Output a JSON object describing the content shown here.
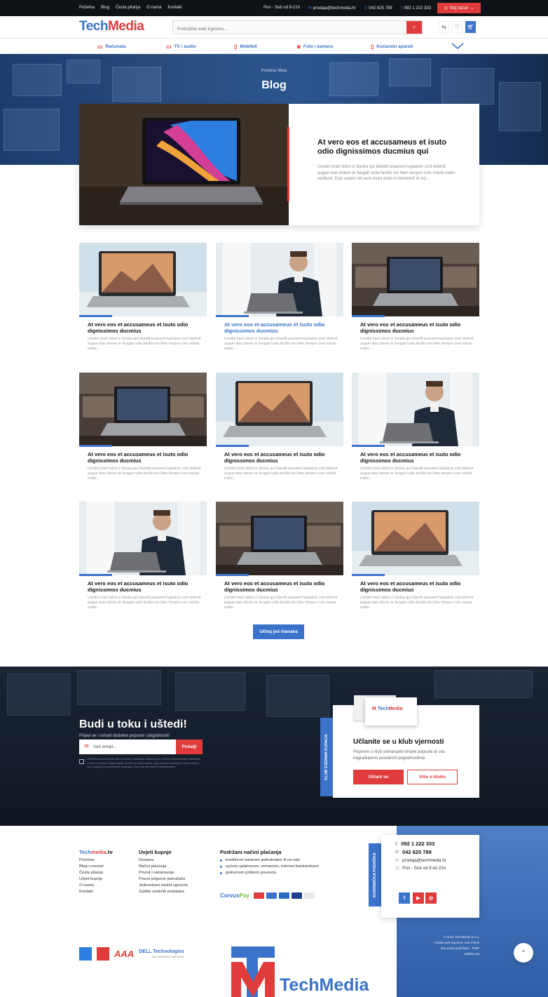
{
  "topbar": {
    "links": [
      "Početna",
      "Blog",
      "Česta pitanja",
      "O nama",
      "Kontakt"
    ],
    "hours": "Pon - Sub od 8-21h",
    "email": "prodaja@techmedia.hr",
    "phone1": "042 625 789",
    "phone2": "092 1 222 333",
    "account": "Moj račun"
  },
  "header": {
    "logo_a": "Tech",
    "logo_b": "Media",
    "search_placeholder": "Pretražite web trgovinu..."
  },
  "categories": [
    "Računala",
    "TV i audio",
    "Mobiteli",
    "Foto i kamera",
    "Kućanski aparati"
  ],
  "hero": {
    "breadcrumb": "Početna / Blog",
    "title": "Blog"
  },
  "featured": {
    "title": "At vero eos et accusameus et isuto odio dignissimos ducmius qui",
    "text": "Uvodni kraći tekst iz članka qui blandit praesent luptatum zzril delenit augue duis dolore te feugait nulla facilisi am liber tempor cum soluta nobis eleifend. Duis autem vel eum iriure dolor in hendrerit in vul..."
  },
  "articles": [
    {
      "title": "At vero eos et accusameus et isuto odio dignissimos ducmius",
      "text": "Uvodni kraći tekst iz članka qui blandit praesent luptatum zzril delenit augue duis dolore te feugait nulla facilisi am liber tempor cum soluta nobis...",
      "image": "laptop-desk"
    },
    {
      "title": "At vero eos et accusameus et isuto odio dignissimos ducmius",
      "text": "Uvodni kraći tekst iz članka qui blandit praesent luptatum zzril delenit augue duis dolore te feugait nulla facilisi am liber tempor cum soluta nobis...",
      "image": "man-laptop"
    },
    {
      "title": "At vero eos et accusameus et isuto odio dignissimos ducmius",
      "text": "Uvodni kraći tekst iz članka qui blandit praesent luptatum zzril delenit augue duis dolore te feugait nulla facilisi am liber tempor cum soluta nobis...",
      "image": "laptop-shop"
    },
    {
      "title": "At vero eos et accusameus et isuto odio dignissimos ducmius",
      "text": "Uvodni kraći tekst iz članka qui blandit praesent luptatum zzril delenit augue duis dolore te feugait nulla facilisi am liber tempor cum soluta nobis...",
      "image": "laptop-shop"
    },
    {
      "title": "At vero eos et accusameus et isuto odio dignissimos ducmius",
      "text": "Uvodni kraći tekst iz članka qui blandit praesent luptatum zzril delenit augue duis dolore te feugait nulla facilisi am liber tempor cum soluta nobis...",
      "image": "laptop-desk"
    },
    {
      "title": "At vero eos et accusameus et isuto odio dignissimos ducmius",
      "text": "Uvodni kraći tekst iz članka qui blandit praesent luptatum zzril delenit augue duis dolore te feugait nulla facilisi am liber tempor cum soluta nobis...",
      "image": "man-laptop"
    },
    {
      "title": "At vero eos et accusameus et isuto odio dignissimos ducmius",
      "text": "Uvodni kraći tekst iz članka qui blandit praesent luptatum zzril delenit augue duis dolore te feugait nulla facilisi am liber tempor cum soluta nobis...",
      "image": "man-laptop"
    },
    {
      "title": "At vero eos et accusameus et isuto odio dignissimos ducmius",
      "text": "Uvodni kraći tekst iz članka qui blandit praesent luptatum zzril delenit augue duis dolore te feugait nulla facilisi am liber tempor cum soluta nobis...",
      "image": "laptop-shop"
    },
    {
      "title": "At vero eos et accusameus et isuto odio dignissimos ducmius",
      "text": "Uvodni kraći tekst iz članka qui blandit praesent luptatum zzril delenit augue duis dolore te feugait nulla facilisi am liber tempor cum soluta nobis...",
      "image": "laptop-desk"
    }
  ],
  "load_more": "Učitaj još članaka",
  "newsletter": {
    "title": "Budi u toku i uštedi!",
    "subtitle": "Prijavi se i ostvari dodatne popuste i pogodnosti!",
    "email_placeholder": "Vaš email...",
    "send": "Pošalji",
    "legal": "GDPR tekst lorem ipsum dolor sit amet, consectetur adipiscing elit, sed do eiusmod tempor incididunt ut labore et dolore magna aliqua. Ut enim ad minim veniam, quis nostrud exercitation ullamco laboris nisi ut aliquip ex ea commodo consequat. Duis aute irure dolor in reprehenderit."
  },
  "club": {
    "tab": "KLUB VJERNIH KUPACA",
    "title": "Učlanite se u klub vjernosti",
    "text": "Prijavom u klub ostvarujete brojne popuste te vas nagrađujemo posebnim pogodnostima.",
    "join": "Učlani se",
    "more": "Više o klubu",
    "card_a": "Tech",
    "card_b": "Media"
  },
  "footer": {
    "brand_a": "Tech",
    "brand_b": "media",
    "brand_c": ".hr",
    "brand_links": [
      "Početna",
      "Blog i novosti",
      "Česta pitanja",
      "Uvjeti kupnje",
      "O nama",
      "Kontakt"
    ],
    "terms_title": "Uvjeti kupnje",
    "terms_links": [
      "Dostava",
      "Načini plaćanja",
      "Povrat i reklamacije",
      "Pravni prigovor potrošača",
      "Jednostrani raskid ugovora",
      "Zaštita osobnih podataka"
    ],
    "pay_title": "Podržani načini plaćanja",
    "pay_items": [
      "kreditnom karticom jednokratno ili na rate",
      "općom uplatnicom, virmanom, internet bankarstvom",
      "gotovinom prilikom pouzeća"
    ],
    "corvus_a": "Corvus",
    "corvus_b": "Pay",
    "support_tab": "KORISNIČKA PODRŠKA",
    "support_phone1": "092 1 222 333",
    "support_phone2": "042 625 789",
    "support_email": "prodaja@techmedia.hr",
    "support_hours": "Pon - Sub od 8 do 21h",
    "copyright": [
      "© 2021 TechMedia d.o.o.",
      "Izrada web trgovine: Lea Pisnić",
      "Sva prava pridržana - RMP",
      "Zaštita sut"
    ],
    "partner_dell": "DELL Technologies",
    "partner_dell_sub": "AUTHORIZED PARTNER",
    "partner_aaa": "AAA",
    "bottom_logo": "TechMedia"
  },
  "colors": {
    "brand_blue": "#3a73c9",
    "brand_red": "#e03c3c",
    "dark": "#0f1216"
  }
}
